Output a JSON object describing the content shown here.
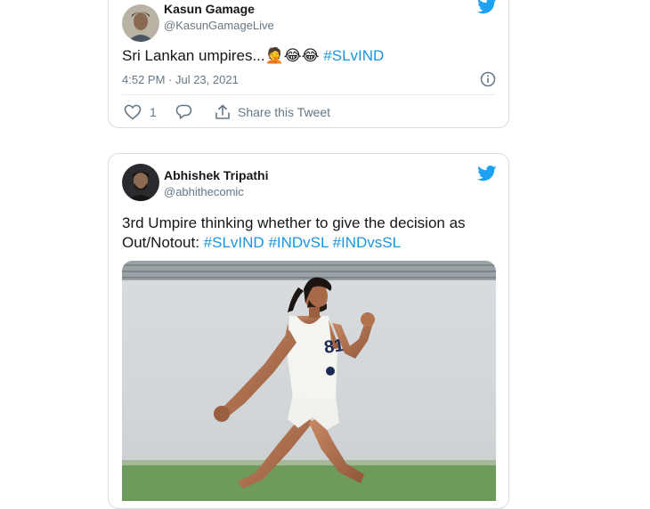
{
  "colors": {
    "twitter_blue": "#1da1f2",
    "link_blue": "#1b95e0",
    "secondary_text": "#657786",
    "border": "#d7dde2"
  },
  "tweets": [
    {
      "author_name": "Kasun Gamage",
      "author_handle": "@KasunGamageLive",
      "text": "Sri Lankan umpires...",
      "emojis": "🤦😂😂",
      "hashtags": [
        "#SLvIND"
      ],
      "timestamp": "4:52 PM · Jul 23, 2021",
      "like_count": "1",
      "share_label": "Share this Tweet",
      "icons": [
        "twitter-bird-icon",
        "info-icon",
        "heart-icon",
        "reply-icon",
        "share-icon"
      ]
    },
    {
      "author_name": "Abhishek Tripathi",
      "author_handle": "@abhithecomic",
      "text_line1": "3rd Umpire thinking whether to give the decision as",
      "text_line2_prefix": "Out/Notout:",
      "hashtags": [
        "#SLvIND",
        "#INDvSL",
        "#INDvsSL"
      ],
      "media_bib_text": "81",
      "icons": [
        "twitter-bird-icon"
      ]
    }
  ]
}
